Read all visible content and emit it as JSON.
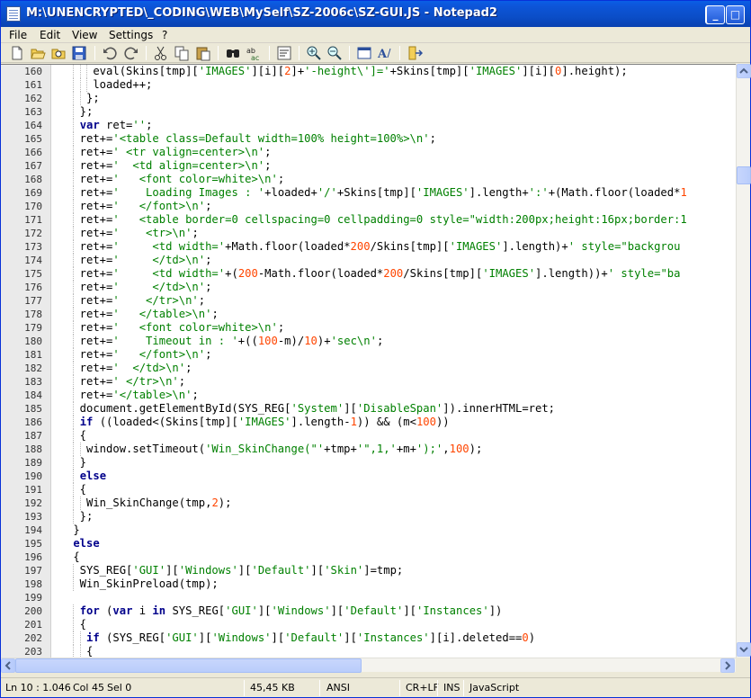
{
  "window": {
    "title": "M:\\UNENCRYPTED\\_CODING\\WEB\\MySelf\\SZ-2006c\\SZ-GUI.JS - Notepad2"
  },
  "titlebar_buttons": {
    "minimize": "_",
    "maximize": "□",
    "close": "✕"
  },
  "menu": [
    "File",
    "Edit",
    "View",
    "Settings",
    "?"
  ],
  "toolbar_icons": [
    "new-file-icon",
    "open-folder-icon",
    "browse-icon",
    "save-icon",
    "undo-icon",
    "redo-icon",
    "cut-icon",
    "copy-icon",
    "paste-icon",
    "find-icon",
    "replace-icon",
    "word-wrap-icon",
    "zoom-in-icon",
    "zoom-out-icon",
    "scheme-icon",
    "font-icon",
    "exit-icon"
  ],
  "lines": [
    {
      "n": "160",
      "t": "    eval(Skins[tmp]['IMAGES'][i][2]+'-height\\']='+Skins[tmp]['IMAGES'][i][0].height);"
    },
    {
      "n": "161",
      "t": "    loaded++;"
    },
    {
      "n": "162",
      "t": "   };"
    },
    {
      "n": "163",
      "t": "  };"
    },
    {
      "n": "164",
      "t": "  var ret='';"
    },
    {
      "n": "165",
      "t": "  ret+='<table class=Default width=100% height=100%>\\n';"
    },
    {
      "n": "166",
      "t": "  ret+=' <tr valign=center>\\n';"
    },
    {
      "n": "167",
      "t": "  ret+='  <td align=center>\\n';"
    },
    {
      "n": "168",
      "t": "  ret+='   <font color=white>\\n';"
    },
    {
      "n": "169",
      "t": "  ret+='    Loading Images : '+loaded+'/'+Skins[tmp]['IMAGES'].length+':'+(Math.floor(loaded*1"
    },
    {
      "n": "170",
      "t": "  ret+='   </font>\\n';"
    },
    {
      "n": "171",
      "t": "  ret+='   <table border=0 cellspacing=0 cellpadding=0 style=\"width:200px;height:16px;border:1"
    },
    {
      "n": "172",
      "t": "  ret+='    <tr>\\n';"
    },
    {
      "n": "173",
      "t": "  ret+='     <td width='+Math.floor(loaded*200/Skins[tmp]['IMAGES'].length)+' style=\"backgrou"
    },
    {
      "n": "174",
      "t": "  ret+='     </td>\\n';"
    },
    {
      "n": "175",
      "t": "  ret+='     <td width='+(200-Math.floor(loaded*200/Skins[tmp]['IMAGES'].length))+' style=\"ba"
    },
    {
      "n": "176",
      "t": "  ret+='     </td>\\n';"
    },
    {
      "n": "177",
      "t": "  ret+='    </tr>\\n';"
    },
    {
      "n": "178",
      "t": "  ret+='   </table>\\n';"
    },
    {
      "n": "179",
      "t": "  ret+='   <font color=white>\\n';"
    },
    {
      "n": "180",
      "t": "  ret+='    Timeout in : '+((100-m)/10)+'sec\\n';"
    },
    {
      "n": "181",
      "t": "  ret+='   </font>\\n';"
    },
    {
      "n": "182",
      "t": "  ret+='  </td>\\n';"
    },
    {
      "n": "183",
      "t": "  ret+=' </tr>\\n';"
    },
    {
      "n": "184",
      "t": "  ret+='</table>\\n';"
    },
    {
      "n": "185",
      "t": "  document.getElementById(SYS_REG['System']['DisableSpan']).innerHTML=ret;"
    },
    {
      "n": "186",
      "t": "  if ((loaded<(Skins[tmp]['IMAGES'].length-1)) && (m<100))"
    },
    {
      "n": "187",
      "t": "  {"
    },
    {
      "n": "188",
      "t": "   window.setTimeout('Win_SkinChange(\"'+tmp+'\",1,'+m+');',100);"
    },
    {
      "n": "189",
      "t": "  }"
    },
    {
      "n": "190",
      "t": "  else"
    },
    {
      "n": "191",
      "t": "  {"
    },
    {
      "n": "192",
      "t": "   Win_SkinChange(tmp,2);"
    },
    {
      "n": "193",
      "t": "  };"
    },
    {
      "n": "194",
      "t": " }"
    },
    {
      "n": "195",
      "t": " else"
    },
    {
      "n": "196",
      "t": " {"
    },
    {
      "n": "197",
      "t": "  SYS_REG['GUI']['Windows']['Default']['Skin']=tmp;"
    },
    {
      "n": "198",
      "t": "  Win_SkinPreload(tmp);"
    },
    {
      "n": "199",
      "t": ""
    },
    {
      "n": "200",
      "t": "  for (var i in SYS_REG['GUI']['Windows']['Default']['Instances'])"
    },
    {
      "n": "201",
      "t": "  {"
    },
    {
      "n": "202",
      "t": "   if (SYS_REG['GUI']['Windows']['Default']['Instances'][i].deleted==0)"
    },
    {
      "n": "203",
      "t": "   {"
    }
  ],
  "status": {
    "position": "Ln 10 : 1.046",
    "col": "Col 45",
    "sel": "Sel 0",
    "size": "45,45 KB",
    "encoding": "ANSI",
    "eol": "CR+LF",
    "mode": "INS",
    "lexer": "JavaScript"
  },
  "colors": {
    "keyword": "#00008b",
    "string": "#008000",
    "number": "#ff4500"
  }
}
